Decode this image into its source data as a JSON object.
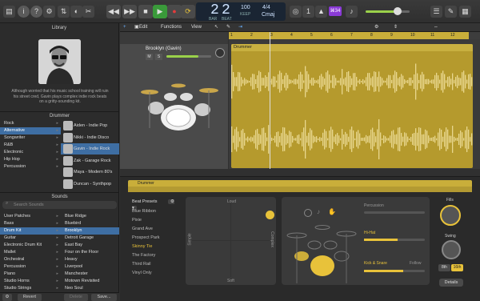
{
  "colors": {
    "accent": "#e8c23a",
    "selection": "#3e6ea3",
    "region": "#b59a2d",
    "lcd": "#1a2533",
    "record": "#e23c3c",
    "play": "#3a9a3a",
    "volume_fill": "#9ad14a"
  },
  "toolbar": {
    "icons": [
      "library-icon",
      "info-icon",
      "help-icon",
      "settings-icon",
      "mixer-icon",
      "editor-icon",
      "scissors-icon"
    ],
    "lcd": {
      "bar": "2",
      "beat": "2",
      "bar_label": "BAR",
      "beat_label": "BEAT",
      "tempo": "100",
      "tempo_label": "KEEP",
      "key": "Cmaj",
      "time_sig": "4/4"
    },
    "badge": "⌘34",
    "master_volume": 0.72
  },
  "library": {
    "title": "Library",
    "description": "Although worried that his music school training will ruin his street cred, Gavin plays complex indie rock beats on a gritty-sounding kit.",
    "drummer_header": "Drummer",
    "genres": [
      "Rock",
      "Alternative",
      "Songwriter",
      "R&B",
      "Electronic",
      "Hip Hop",
      "Percussion"
    ],
    "selected_genre": 1,
    "drummers": [
      "Aiden - Indie Pop",
      "Nikki - Indie Disco",
      "Gavin - Indie Rock",
      "Zak - Garage Rock",
      "Maya - Modern 80's",
      "Duncan - Synthpop"
    ],
    "selected_drummer": 2,
    "sounds_header": "Sounds",
    "search_placeholder": "Search Sounds",
    "sound_categories": [
      "User Patches",
      "Bass",
      "Drum Kit",
      "Guitar",
      "Electronic Drum Kit",
      "Mallet",
      "Orchestral",
      "Percussion",
      "Piano",
      "Studio Horns",
      "Studio Strings"
    ],
    "selected_category": 2,
    "sound_patches": [
      "Blue Ridge",
      "Bluebird",
      "Brooklyn",
      "Detroit Garage",
      "East Bay",
      "Four on the Floor",
      "Heavy",
      "Liverpool",
      "Manchester",
      "Motown Revisited",
      "Neo Soul"
    ],
    "selected_patch": 2,
    "footer": {
      "revert": "Revert",
      "delete": "Delete",
      "save": "Save..."
    }
  },
  "tracks": {
    "menus": [
      "Edit",
      "Functions",
      "View"
    ],
    "track_name": "Brooklyn (Gavin)",
    "track_buttons": [
      "M",
      "S"
    ],
    "region_name": "Drummer",
    "ruler_marks": [
      "1",
      "2",
      "3",
      "4",
      "5",
      "6",
      "7",
      "8",
      "9",
      "10",
      "11",
      "12"
    ]
  },
  "editor": {
    "header_label": "Drummer",
    "presets_label": "Beat Presets",
    "presets": [
      "Blue Ribbon",
      "Pixie",
      "Grand Ave",
      "Prospect Park",
      "Skinny Tie",
      "The Factory",
      "Third Rail",
      "Vinyl Only"
    ],
    "active_preset": 4,
    "pad_labels": {
      "top": "Loud",
      "bottom": "Soft",
      "left": "Simple",
      "right": "Complex"
    },
    "kit_labels": {
      "percussion": "Percussion",
      "hihat": "Hi-Hat",
      "kick_snare": "Kick & Snare",
      "follow": "Follow"
    },
    "fills_label": "Fills",
    "swing_label": "Swing",
    "swing_options": [
      "8th",
      "16th"
    ],
    "details_label": "Details"
  }
}
